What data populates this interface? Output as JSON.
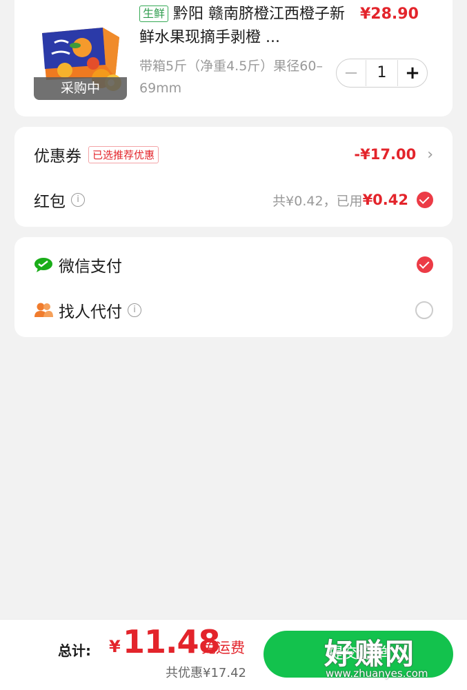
{
  "product": {
    "tag": "生鲜",
    "title": "黔阳 赣南脐橙江西橙子新鲜水果现摘手剥橙 ...",
    "price": "¥28.90",
    "spec": "带箱5斤（净重4.5斤）果径60–69mm",
    "status": "采购中",
    "quantity": "1",
    "minus": "−",
    "plus": "+"
  },
  "discounts": {
    "coupon_label": "优惠券",
    "coupon_badge": "已选推荐优惠",
    "coupon_amount": "-¥17.00",
    "redpacket_label": "红包",
    "redpacket_total": "共¥0.42，已用",
    "redpacket_used": "¥0.42"
  },
  "payment": {
    "wechat_label": "微信支付",
    "friend_label": "找人代付"
  },
  "bottom": {
    "total_label": "总计:",
    "currency": "¥",
    "total": "11.48",
    "shipping": "免运费",
    "saved": "共优惠¥17.42",
    "submit": "提交订单"
  },
  "watermark": {
    "big": "好赚网",
    "small": "www.zhuanyes.com"
  },
  "colors": {
    "price_red": "#e3242b",
    "wechat_green": "#13c24d",
    "check_red": "#ec3b46"
  }
}
